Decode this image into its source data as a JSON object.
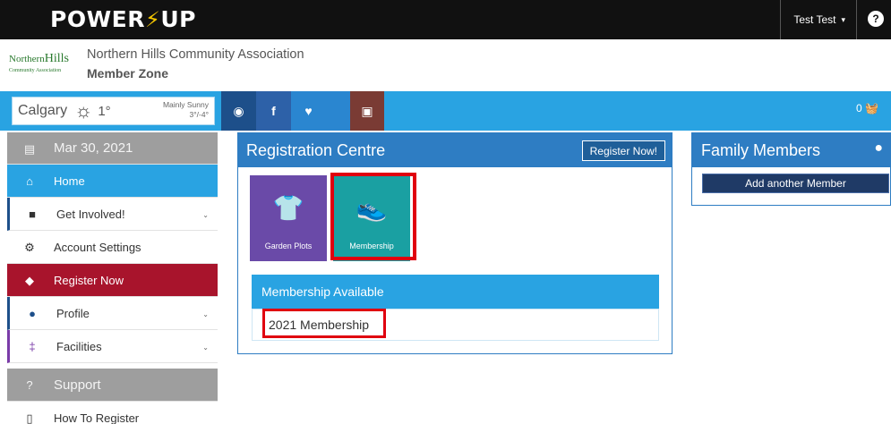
{
  "topbar": {
    "logo_left": "POWER",
    "logo_right": "UP",
    "user_name": "Test Test",
    "help_label": "?"
  },
  "header": {
    "org_logo_line1": "Northern",
    "org_logo_line2": "Hills",
    "org_logo_line3": "Community Association",
    "org_name": "Northern Hills Community Association",
    "zone": "Member Zone"
  },
  "weather": {
    "city": "Calgary",
    "temp": "1°",
    "condition": "Mainly Sunny",
    "range": "3°/-4°"
  },
  "social": {
    "globe": "◉",
    "facebook": "f",
    "twitter": "♥",
    "instagram": "▣"
  },
  "cart": {
    "count": "0"
  },
  "sidebar": {
    "date": "Mar 30, 2021",
    "items": [
      {
        "label": "Home"
      },
      {
        "label": "Get Involved!"
      },
      {
        "label": "Account Settings"
      },
      {
        "label": "Register Now"
      },
      {
        "label": "Profile"
      },
      {
        "label": "Facilities"
      }
    ],
    "support": "Support",
    "how_to": "How To Register"
  },
  "registration": {
    "title": "Registration Centre",
    "register_button": "Register Now!",
    "tiles": [
      {
        "label": "Garden Plots"
      },
      {
        "label": "Membership"
      }
    ],
    "available_title": "Membership Available",
    "available_item": "2021 Membership"
  },
  "family": {
    "title": "Family Members",
    "add_button": "Add another Member"
  },
  "colors": {
    "topbar": "#111111",
    "accent_blue": "#29a3e2",
    "panel_blue": "#2e7dc3",
    "register_red": "#a8142c",
    "highlight_red": "#e0000f"
  }
}
